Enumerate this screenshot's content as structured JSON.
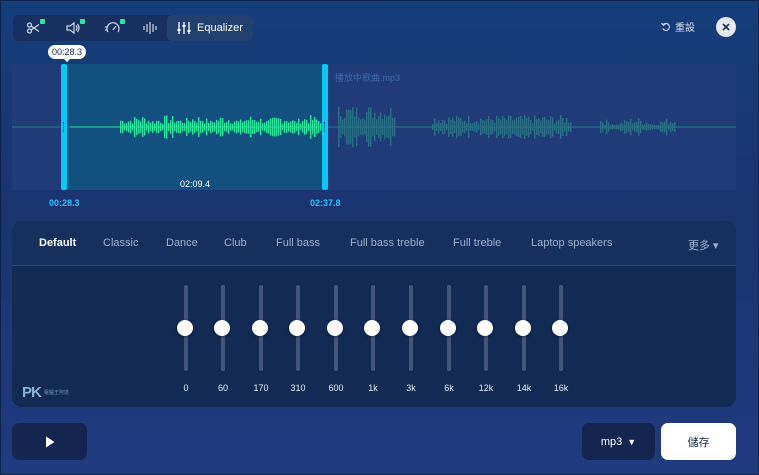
{
  "toolbar": {
    "items": [
      {
        "icon": "scissors-icon",
        "has_indicator": true
      },
      {
        "icon": "volume-icon",
        "has_indicator": true
      },
      {
        "icon": "speed-icon",
        "has_indicator": true
      },
      {
        "icon": "waveform-icon",
        "has_indicator": false
      },
      {
        "icon": "equalizer-icon",
        "label": "Equalizer",
        "active": true
      }
    ],
    "equalizer_label": "Equalizer",
    "reset_label": "重設"
  },
  "timeline": {
    "file_name": "播放中歌曲.mp3",
    "start_bubble": "00:28.3",
    "selection_duration": "02:09.4",
    "start_time": "00:28.3",
    "end_time": "02:37.8"
  },
  "presets": {
    "items": [
      "Default",
      "Classic",
      "Dance",
      "Club",
      "Full bass",
      "Full bass treble",
      "Full treble",
      "Laptop speakers"
    ],
    "active": "Default",
    "more_label": "更多 ▾"
  },
  "bands": {
    "labels": [
      "0",
      "60",
      "170",
      "310",
      "600",
      "1k",
      "3k",
      "6k",
      "12k",
      "14k",
      "16k"
    ],
    "levels": [
      0,
      0,
      0,
      0,
      0,
      0,
      0,
      0,
      0,
      0,
      0
    ]
  },
  "watermark": {
    "text": "PK",
    "sub": "電腦王阿達"
  },
  "footer": {
    "format_label": "mp3",
    "save_label": "儲存"
  },
  "colors": {
    "accent_cyan": "#08c9f4",
    "wave_green": "#2ee59d",
    "background": "#1a3470"
  }
}
